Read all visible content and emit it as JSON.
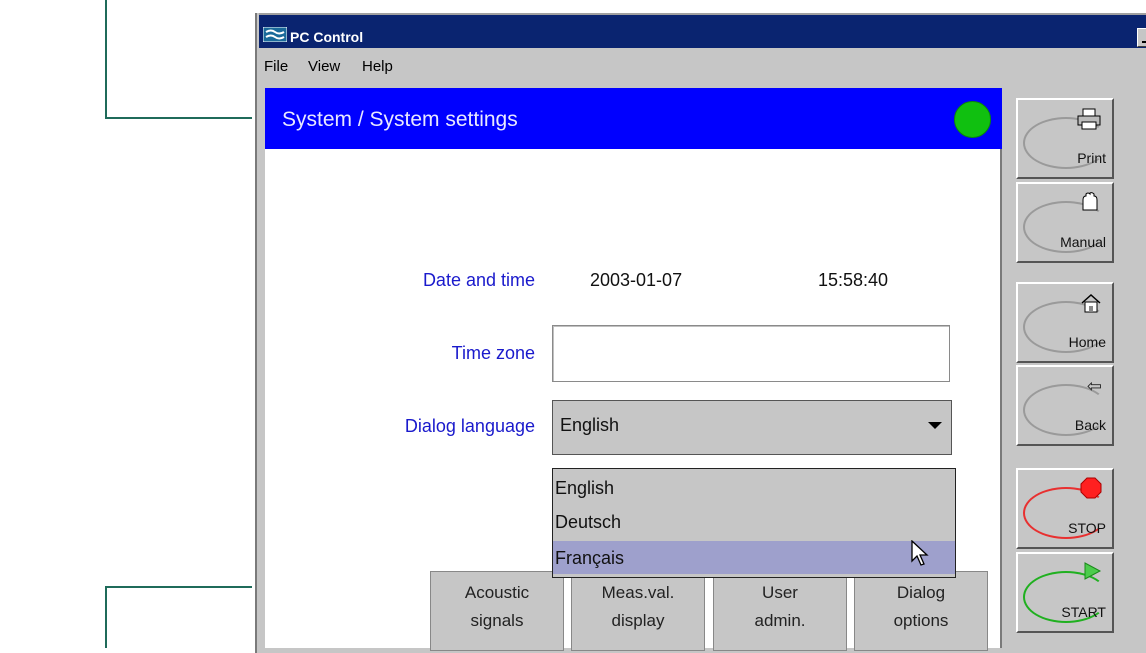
{
  "window": {
    "title": "PC Control"
  },
  "menu": [
    "File",
    "View",
    "Help"
  ],
  "header": {
    "title": "System / System settings",
    "status_color": "#10c010"
  },
  "settings": {
    "date_time_label": "Date and time",
    "date": "2003-01-07",
    "time": "15:58:40",
    "time_zone_label": "Time zone",
    "time_zone_value": "",
    "language_label": "Dialog language",
    "language_value": "English",
    "language_options": [
      "English",
      "Deutsch",
      "Français"
    ],
    "hovered_option": "Français"
  },
  "bottom_tabs": [
    {
      "line1": "Acoustic",
      "line2": "signals"
    },
    {
      "line1": "Meas.val.",
      "line2": "display"
    },
    {
      "line1": "User",
      "line2": "admin."
    },
    {
      "line1": "Dialog",
      "line2": "options"
    }
  ],
  "sidebar": {
    "print": "Print",
    "manual": "Manual",
    "home": "Home",
    "back": "Back",
    "stop": "STOP",
    "start": "START",
    "icons": {
      "print": "printer-icon",
      "manual": "hand-icon",
      "home": "home-icon",
      "back": "back-arrow-icon",
      "stop": "stop-icon",
      "start": "play-icon"
    },
    "colors": {
      "stop": "#e83030",
      "start": "#20b020"
    }
  }
}
